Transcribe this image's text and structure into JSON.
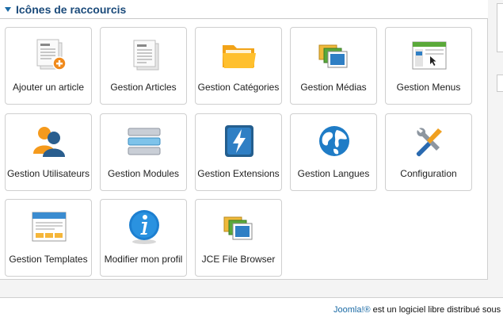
{
  "panel": {
    "title": "Icônes de raccourcis"
  },
  "tiles": [
    {
      "label": "Ajouter un article",
      "icon": "add-article-icon"
    },
    {
      "label": "Gestion Articles",
      "icon": "articles-icon"
    },
    {
      "label": "Gestion Catégories",
      "icon": "folder-icon"
    },
    {
      "label": "Gestion Médias",
      "icon": "media-icon"
    },
    {
      "label": "Gestion Menus",
      "icon": "menus-icon"
    },
    {
      "label": "Gestion Utilisateurs",
      "icon": "users-icon"
    },
    {
      "label": "Gestion Modules",
      "icon": "modules-icon"
    },
    {
      "label": "Gestion Extensions",
      "icon": "extensions-icon"
    },
    {
      "label": "Gestion Langues",
      "icon": "globe-icon"
    },
    {
      "label": "Configuration",
      "icon": "tools-icon"
    },
    {
      "label": "Gestion Templates",
      "icon": "templates-icon"
    },
    {
      "label": "Modifier mon profil",
      "icon": "info-icon"
    },
    {
      "label": "JCE File Browser",
      "icon": "file-browser-icon"
    }
  ],
  "footer": {
    "link": "Joomla!®",
    "text": " est un logiciel libre distribué sous l"
  }
}
